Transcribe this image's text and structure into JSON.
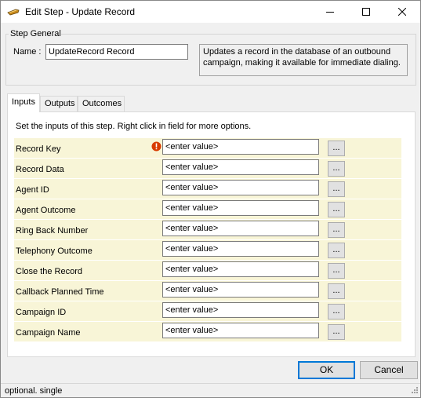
{
  "window": {
    "title": "Edit Step - Update Record",
    "icon": "app-icon"
  },
  "step_general": {
    "legend": "Step General",
    "name_label": "Name :",
    "name_value": "UpdateRecord Record",
    "description": "Updates a record in the database of an outbound campaign, making it available for immediate dialing."
  },
  "tabs": [
    {
      "label": "Inputs",
      "active": true
    },
    {
      "label": "Outputs",
      "active": false
    },
    {
      "label": "Outcomes",
      "active": false
    }
  ],
  "inputs_panel": {
    "description": "Set the inputs of this step.  Right click in field for more options.",
    "browse_label": "...",
    "rows": [
      {
        "label": "Record Key",
        "value": "<enter value>",
        "warning": true
      },
      {
        "label": "Record Data",
        "value": "<enter value>",
        "warning": false
      },
      {
        "label": "Agent ID",
        "value": "<enter value>",
        "warning": false
      },
      {
        "label": "Agent Outcome",
        "value": "<enter value>",
        "warning": false
      },
      {
        "label": "Ring Back Number",
        "value": "<enter value>",
        "warning": false
      },
      {
        "label": "Telephony Outcome",
        "value": "<enter value>",
        "warning": false
      },
      {
        "label": "Close the Record",
        "value": "<enter value>",
        "warning": false
      },
      {
        "label": "Callback Planned Time",
        "value": "<enter value>",
        "warning": false
      },
      {
        "label": "Campaign ID",
        "value": "<enter value>",
        "warning": false
      },
      {
        "label": "Campaign Name",
        "value": "<enter value>",
        "warning": false
      }
    ]
  },
  "buttons": {
    "ok": "OK",
    "cancel": "Cancel"
  },
  "status": {
    "text": "optional. single"
  },
  "colors": {
    "row_background": "#f8f5d7",
    "focus_border": "#0078d7",
    "warning": "#d83b01"
  }
}
